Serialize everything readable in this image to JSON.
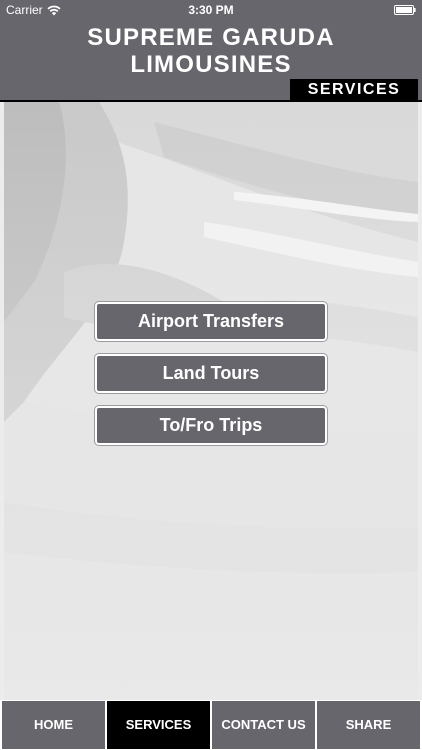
{
  "status_bar": {
    "carrier": "Carrier",
    "time": "3:30 PM"
  },
  "header": {
    "title": "SUPREME GARUDA\nLIMOUSINES",
    "section": "SERVICES"
  },
  "menu": {
    "items": [
      {
        "label": "Airport Transfers"
      },
      {
        "label": "Land Tours"
      },
      {
        "label": "To/Fro Trips"
      }
    ]
  },
  "tabs": [
    {
      "label": "HOME"
    },
    {
      "label": "SERVICES",
      "active": true
    },
    {
      "label": "CONTACT US"
    },
    {
      "label": "SHARE"
    }
  ],
  "colors": {
    "bar": "#67666d",
    "active_tab": "#000000",
    "background": "#ececec",
    "text": "#ffffff"
  },
  "icons": {
    "wifi": "wifi-icon",
    "battery": "battery-icon"
  }
}
